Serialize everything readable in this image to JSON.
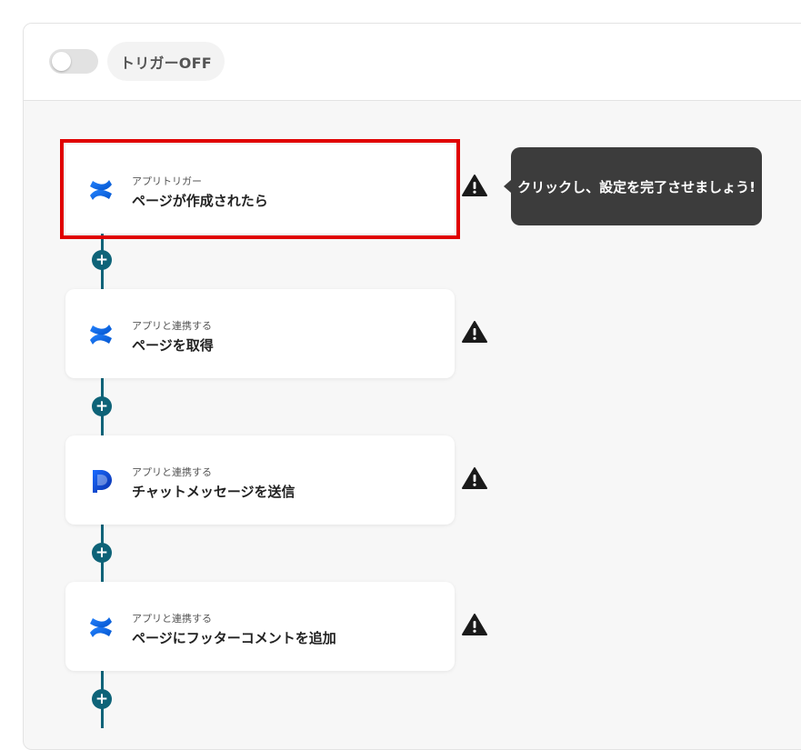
{
  "header": {
    "trigger_label": "トリガーOFF"
  },
  "tooltip": {
    "text": "クリックし、設定を完了させましょう!"
  },
  "steps": [
    {
      "subtitle": "アプリトリガー",
      "title": "ページが作成されたら",
      "icon": "confluence-icon"
    },
    {
      "subtitle": "アプリと連携する",
      "title": "ページを取得",
      "icon": "confluence-icon"
    },
    {
      "subtitle": "アプリと連携する",
      "title": "チャットメッセージを送信",
      "icon": "chat-app-icon"
    },
    {
      "subtitle": "アプリと連携する",
      "title": "ページにフッターコメントを追加",
      "icon": "confluence-icon"
    }
  ],
  "add_symbol": "+",
  "colors": {
    "rail": "#0e6378",
    "highlight": "#e00000",
    "tooltip_bg": "#3c3c3c"
  }
}
